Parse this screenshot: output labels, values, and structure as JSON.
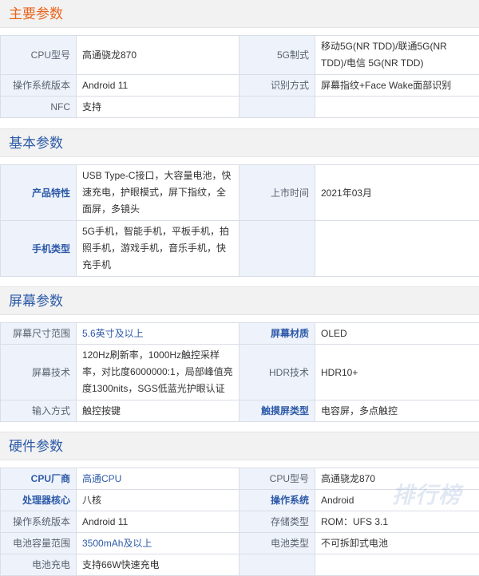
{
  "colors": {
    "section_title": "#e8641b",
    "label_bg": "#eef3fb",
    "link": "#2d5aa8",
    "border": "#d9dde6",
    "header_bg": "#f2f2f2"
  },
  "sections": {
    "main": {
      "title": "主要参数",
      "rows": [
        {
          "l1": "CPU型号",
          "v1": "高通骁龙870",
          "l2": "5G制式",
          "v2": "移动5G(NR TDD)/联通5G(NR TDD)/电信 5G(NR TDD)"
        },
        {
          "l1": "操作系统版本",
          "v1": "Android 11",
          "l2": "识别方式",
          "v2": "屏幕指纹+Face Wake面部识别"
        },
        {
          "l1": "NFC",
          "v1": "支持",
          "l2": "",
          "v2": ""
        }
      ]
    },
    "basic": {
      "title": "基本参数",
      "rows": [
        {
          "l1": "产品特性",
          "v1": "USB Type-C接口，大容量电池，快速充电，护眼模式，屏下指纹，全面屏，多镜头",
          "l2": "上市时间",
          "v2": "2021年03月"
        },
        {
          "l1": "手机类型",
          "v1": "5G手机，智能手机，平板手机，拍照手机，游戏手机，音乐手机，快充手机",
          "l2": "",
          "v2": ""
        }
      ]
    },
    "screen": {
      "title": "屏幕参数",
      "rows": [
        {
          "l1": "屏幕尺寸范围",
          "v1": "5.6英寸及以上",
          "l2": "屏幕材质",
          "v2": "OLED"
        },
        {
          "l1": "屏幕技术",
          "v1": "120Hz刷新率，1000Hz触控采样率，对比度6000000:1，局部峰值亮度1300nits，SGS低蓝光护眼认证",
          "l2": "HDR技术",
          "v2": "HDR10+"
        },
        {
          "l1": "输入方式",
          "v1": "触控按键",
          "l2": "触摸屏类型",
          "v2": "电容屏，多点触控"
        }
      ]
    },
    "hardware": {
      "title": "硬件参数",
      "rows": [
        {
          "l1": "CPU厂商",
          "v1": "高通CPU",
          "l2": "CPU型号",
          "v2": "高通骁龙870"
        },
        {
          "l1": "处理器核心",
          "v1": "八核",
          "l2": "操作系统",
          "v2": "Android"
        },
        {
          "l1": "操作系统版本",
          "v1": "Android 11",
          "l2": "存储类型",
          "v2": "ROM：UFS 3.1"
        },
        {
          "l1": "电池容量范围",
          "v1": "3500mAh及以上",
          "l2": "电池类型",
          "v2": "不可拆卸式电池"
        },
        {
          "l1": "电池充电",
          "v1": "支持66W快速充电",
          "l2": "",
          "v2": ""
        }
      ]
    }
  },
  "watermark": "排行榜"
}
